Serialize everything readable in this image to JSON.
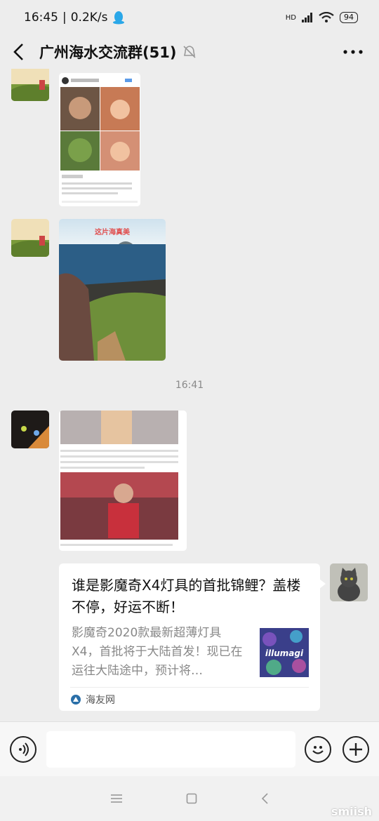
{
  "status_bar": {
    "time": "16:45",
    "speed": "0.2K/s",
    "hd": "HD",
    "battery": "94"
  },
  "header": {
    "title": "广州海水交流群(51)"
  },
  "chat": {
    "image_top": {
      "username": "markrufgrecl0",
      "follow": "关注",
      "caption": "markrufgrecl0 This thing everybody wanted to see #avengers #endgame #marvel #ruiuibuigotss #hulk #mark"
    },
    "image_sea": {
      "overlay_text": "这片海真美"
    },
    "time_divider": "16:41",
    "link_card": {
      "title": "谁是影魔奇X4灯具的首批锦鲤？盖楼不停，好运不断！",
      "description": "影魔奇2020款最新超薄灯具X4，首批将于大陆首发！现已在运往大陆途中，预计将…",
      "thumb_text": "illumagi",
      "source": "海友网"
    }
  },
  "input_bar": {
    "placeholder": ""
  },
  "icons": {
    "back": "back-arrow-icon",
    "mute": "mute-bell-icon",
    "more": "more-dots-icon",
    "voice": "voice-icon",
    "emoji": "emoji-icon",
    "plus": "plus-icon"
  },
  "watermark": "smiish"
}
